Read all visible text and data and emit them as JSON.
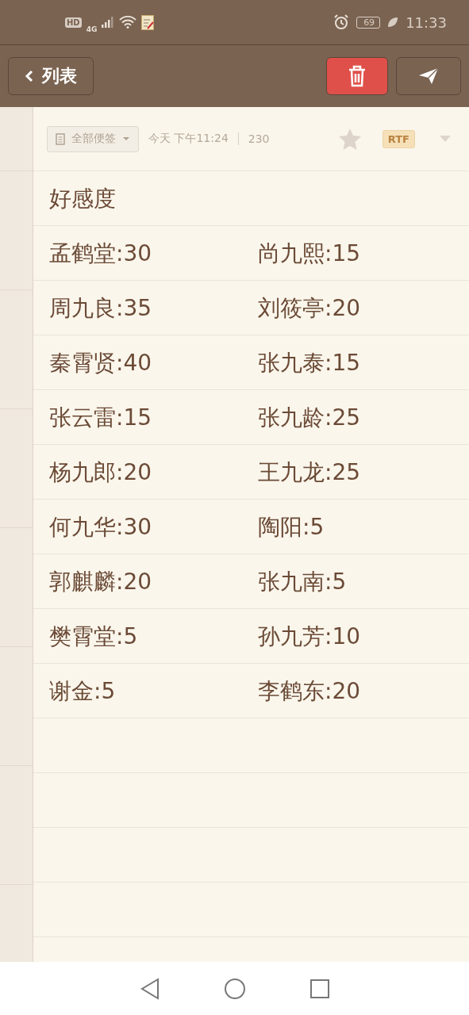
{
  "status_bar": {
    "network": "4G",
    "hd": "HD",
    "battery": "69",
    "time": "11:33"
  },
  "toolbar": {
    "back_label": "列表"
  },
  "meta": {
    "folder": "全部便签",
    "modified": "今天 下午11:24",
    "count": "230",
    "starred": false,
    "format": "RTF"
  },
  "note": {
    "title": "好感度",
    "lines": [
      {
        "left": "孟鹤堂:30",
        "right": "尚九熙:15"
      },
      {
        "left": "周九良:35",
        "right": "刘筱亭:20"
      },
      {
        "left": "秦霄贤:40",
        "right": "张九泰:15"
      },
      {
        "left": "张云雷:15",
        "right": "张九龄:25"
      },
      {
        "left": "杨九郎:20",
        "right": "王九龙:25"
      },
      {
        "left": "何九华:30",
        "right": "陶阳:5"
      },
      {
        "left": "郭麒麟:20",
        "right": "张九南:5"
      },
      {
        "left": "樊霄堂:5",
        "right": "孙九芳:10"
      },
      {
        "left": "谢金:5",
        "right": "李鹤东:20"
      }
    ]
  }
}
